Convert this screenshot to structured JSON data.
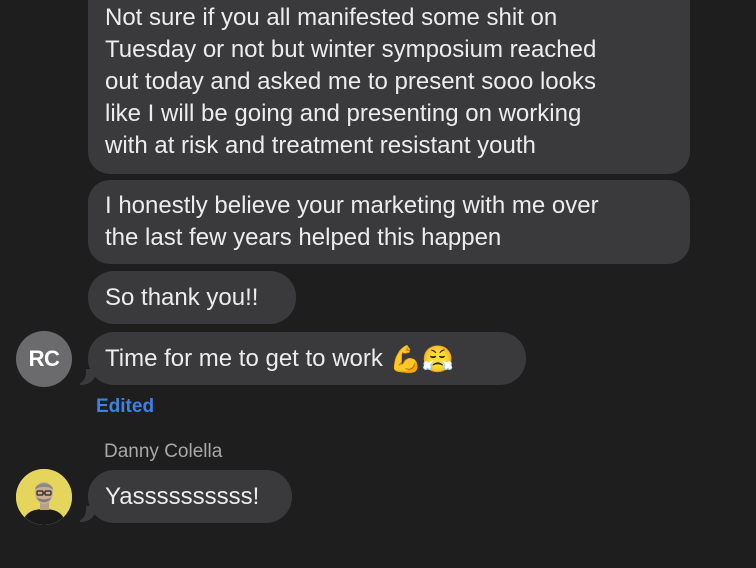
{
  "messages": [
    {
      "text": "Not sure if you all manifested some shit on\nTuesday or not but winter symposium reached\nout today and asked me to present sooo looks\nlike I will be going and presenting on working\nwith at risk and treatment resistant youth"
    },
    {
      "text": "I honestly believe your marketing with me over\nthe last few years helped this happen"
    },
    {
      "text": "So thank you!!"
    },
    {
      "text": "Time for me to get to work",
      "emojis": "💪😤"
    }
  ],
  "first_sender": {
    "initials": "RC",
    "status": "Edited"
  },
  "second_sender": {
    "name": "Danny Colella",
    "message": "Yassssssssss!"
  },
  "colors": {
    "background": "#1e1e1e",
    "bubble": "#3a3a3c",
    "edited": "#3b82e6"
  }
}
